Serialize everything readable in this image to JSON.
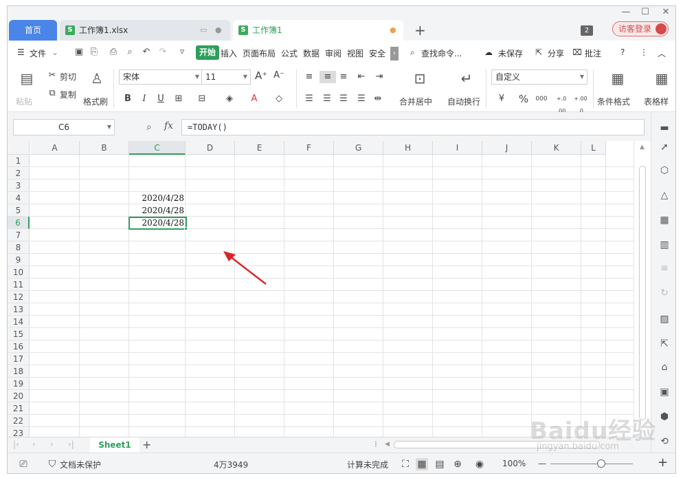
{
  "window": {
    "minimize": "—",
    "maximize": "☐",
    "close": "✕"
  },
  "tabs": {
    "home": "首页",
    "tab1_label": "工作簿1.xlsx",
    "tab2_label": "工作簿1",
    "count_badge": "2",
    "login": "访客登录"
  },
  "menu": {
    "file": "文件",
    "items": [
      "开始",
      "插入",
      "页面布局",
      "公式",
      "数据",
      "审阅",
      "视图",
      "安全"
    ],
    "search": "查找命令...",
    "unsaved": "未保存",
    "share": "分享",
    "annotate": "批注",
    "help": "?"
  },
  "ribbon": {
    "paste": "粘贴",
    "cut": "剪切",
    "copy": "复制",
    "format_painter": "格式刷",
    "font_name": "宋体",
    "font_size": "11",
    "merge_center": "合并居中",
    "wrap_text": "自动换行",
    "number_format": "自定义",
    "percent": "%",
    "thousands": "000",
    "dec_inc": "+.0 .00",
    "dec_dec": "+.00 .0",
    "cond_format": "条件格式",
    "table_style": "表格样"
  },
  "formula": {
    "cell_ref": "C6",
    "fx": "fx",
    "value": "=TODAY()"
  },
  "grid": {
    "columns": [
      "A",
      "B",
      "C",
      "D",
      "E",
      "F",
      "G",
      "H",
      "I",
      "J",
      "K",
      "L"
    ],
    "rows": [
      "1",
      "2",
      "3",
      "4",
      "5",
      "6",
      "7",
      "8",
      "9",
      "10",
      "11",
      "12",
      "13",
      "14",
      "15",
      "16",
      "17",
      "18",
      "19",
      "20",
      "21",
      "22",
      "23"
    ],
    "cells": {
      "C4": "2020/4/28",
      "C5": "2020/4/28",
      "C6": "2020/4/28"
    },
    "selected_cell": "C6"
  },
  "sheets": {
    "active": "Sheet1",
    "add": "+"
  },
  "status": {
    "doc_protect": "文档未保护",
    "count": "4万3949",
    "calc": "计算未完成",
    "zoom": "100%",
    "minus": "—",
    "plus": "+"
  },
  "watermark": {
    "brand": "Baidu经验",
    "url": "jingyan.baidu.com"
  },
  "colors": {
    "accent_green": "#2e9e5b",
    "home_tab_blue": "#4a86e8",
    "annotation_arrow": "#d9262a"
  }
}
